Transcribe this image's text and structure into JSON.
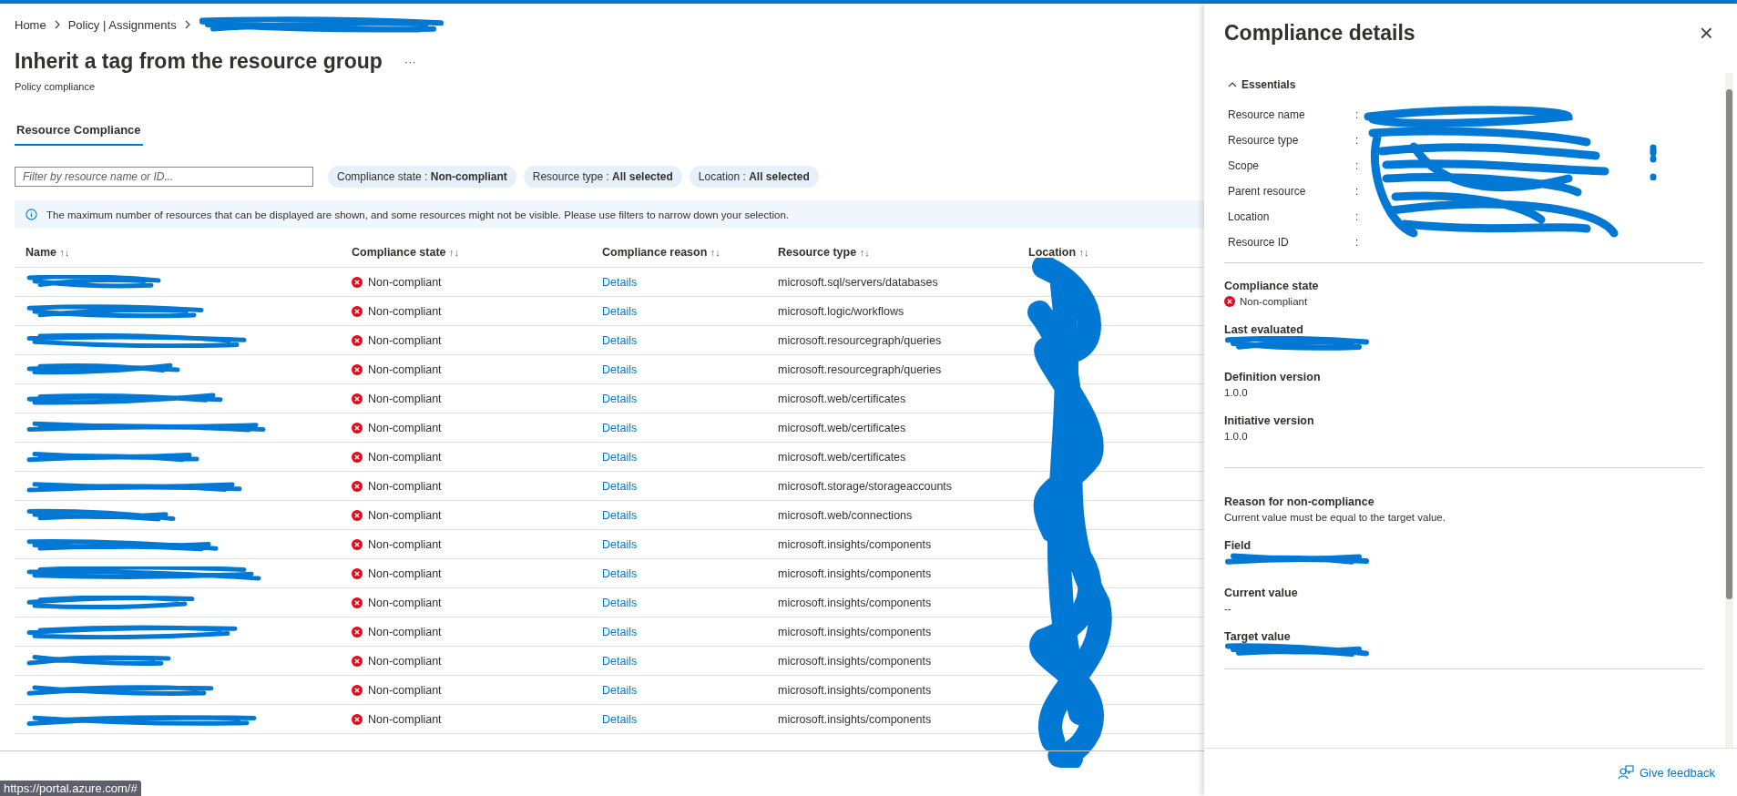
{
  "breadcrumb": [
    {
      "label": "Home"
    },
    {
      "label": "Policy | Assignments"
    },
    {
      "redacted": true
    }
  ],
  "title": "Inherit a tag from the resource group",
  "more": "···",
  "subtitle": "Policy compliance",
  "tabs": [
    {
      "label": "Resource Compliance",
      "selected": true
    }
  ],
  "filter": {
    "placeholder": "Filter by resource name or ID..."
  },
  "pills": [
    {
      "label": "Compliance state : ",
      "value": "Non-compliant"
    },
    {
      "label": "Resource type : ",
      "value": "All selected"
    },
    {
      "label": "Location : ",
      "value": "All selected"
    }
  ],
  "info": "The maximum number of resources that can be displayed are shown, and some resources might not be visible. Please use filters to narrow down your selection.",
  "table": {
    "columns": [
      "Name",
      "Compliance state",
      "Compliance reason",
      "Resource type",
      "Location"
    ],
    "sort_icon": "↑↓",
    "rows": [
      {
        "state": "Non-compliant",
        "reason": "Details",
        "type": "microsoft.sql/servers/databases"
      },
      {
        "state": "Non-compliant",
        "reason": "Details",
        "type": "microsoft.logic/workflows"
      },
      {
        "state": "Non-compliant",
        "reason": "Details",
        "type": "microsoft.resourcegraph/queries"
      },
      {
        "state": "Non-compliant",
        "reason": "Details",
        "type": "microsoft.resourcegraph/queries"
      },
      {
        "state": "Non-compliant",
        "reason": "Details",
        "type": "microsoft.web/certificates"
      },
      {
        "state": "Non-compliant",
        "reason": "Details",
        "type": "microsoft.web/certificates"
      },
      {
        "state": "Non-compliant",
        "reason": "Details",
        "type": "microsoft.web/certificates"
      },
      {
        "state": "Non-compliant",
        "reason": "Details",
        "type": "microsoft.storage/storageaccounts"
      },
      {
        "state": "Non-compliant",
        "reason": "Details",
        "type": "microsoft.web/connections"
      },
      {
        "state": "Non-compliant",
        "reason": "Details",
        "type": "microsoft.insights/components"
      },
      {
        "state": "Non-compliant",
        "reason": "Details",
        "type": "microsoft.insights/components"
      },
      {
        "state": "Non-compliant",
        "reason": "Details",
        "type": "microsoft.insights/components"
      },
      {
        "state": "Non-compliant",
        "reason": "Details",
        "type": "microsoft.insights/components"
      },
      {
        "state": "Non-compliant",
        "reason": "Details",
        "type": "microsoft.insights/components"
      },
      {
        "state": "Non-compliant",
        "reason": "Details",
        "type": "microsoft.insights/components"
      },
      {
        "state": "Non-compliant",
        "reason": "Details",
        "type": "microsoft.insights/components"
      }
    ]
  },
  "status_url": "https://portal.azure.com/#",
  "panel": {
    "title": "Compliance details",
    "close": "×",
    "essentials": {
      "label": "Essentials",
      "expanded": true,
      "separator": ":",
      "fields": [
        "Resource name",
        "Resource type",
        "Scope",
        "Parent resource",
        "Location",
        "Resource ID"
      ]
    },
    "sections": [
      {
        "label": "Compliance state",
        "kind": "state",
        "value": "Non-compliant"
      },
      {
        "label": "Last evaluated",
        "kind": "redacted"
      },
      {
        "label": "Definition version",
        "kind": "text",
        "value": "1.0.0"
      },
      {
        "label": "Initiative version",
        "kind": "text",
        "value": "1.0.0"
      },
      {
        "kind": "divider"
      },
      {
        "label": "Reason for non-compliance",
        "kind": "text",
        "value": "Current value must be equal to the target value."
      },
      {
        "label": "Field",
        "kind": "redacted"
      },
      {
        "label": "Current value",
        "kind": "text",
        "value": "--"
      },
      {
        "label": "Target value",
        "kind": "redacted"
      }
    ],
    "feedback": "Give feedback"
  }
}
